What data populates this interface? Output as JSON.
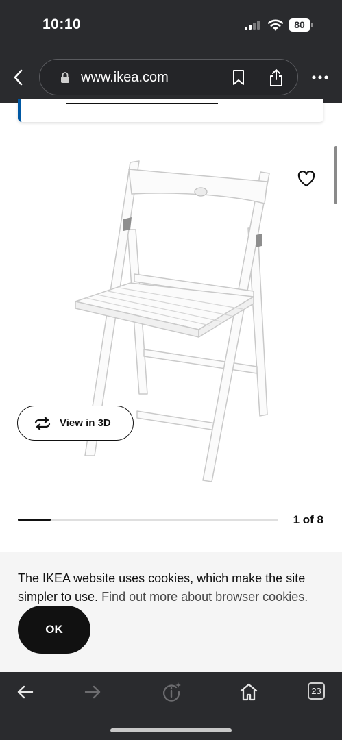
{
  "status_bar": {
    "time": "10:10",
    "battery": "80"
  },
  "browser": {
    "url": "www.ikea.com",
    "tabs_count": "23"
  },
  "product": {
    "view_3d_label": "View in 3D",
    "image_counter": "1 of 8",
    "image_progress": 0.125
  },
  "cookie_banner": {
    "text": "The IKEA website uses cookies, which make the site simpler to use.",
    "link": "Find out more about browser cookies.",
    "ok_label": "OK"
  },
  "icons": {
    "back": "chevron-left-icon",
    "lock": "lock-icon",
    "bookmark": "bookmark-icon",
    "share": "share-icon",
    "more": "ellipsis-icon",
    "favourite": "heart-icon",
    "view3d": "rotate-3d-icon",
    "nav_back": "arrow-left-icon",
    "nav_forward": "arrow-right-icon",
    "reader": "info-sparkle-icon",
    "home": "home-icon"
  },
  "colors": {
    "browser_chrome": "#2a2b2e",
    "ikea_blue": "#0058a3",
    "cookie_bg": "#f5f5f5",
    "button_dark": "#111111"
  }
}
